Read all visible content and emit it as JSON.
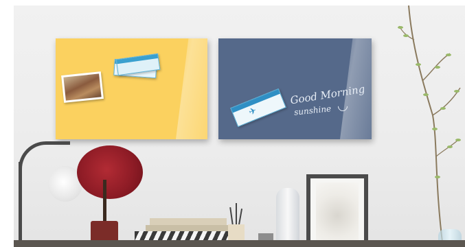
{
  "scene": {
    "description_name": "two glass magnetic boards on wall above desk",
    "colors": {
      "wall": "#eeeeee",
      "yellow_board": "#fbd15f",
      "blue_board": "#55698a",
      "chalk": "#e8eef6",
      "ticket_accent": "#3aa0cf"
    },
    "chalk_text": {
      "line1": "Good Morning",
      "line2": "sunshine"
    }
  }
}
